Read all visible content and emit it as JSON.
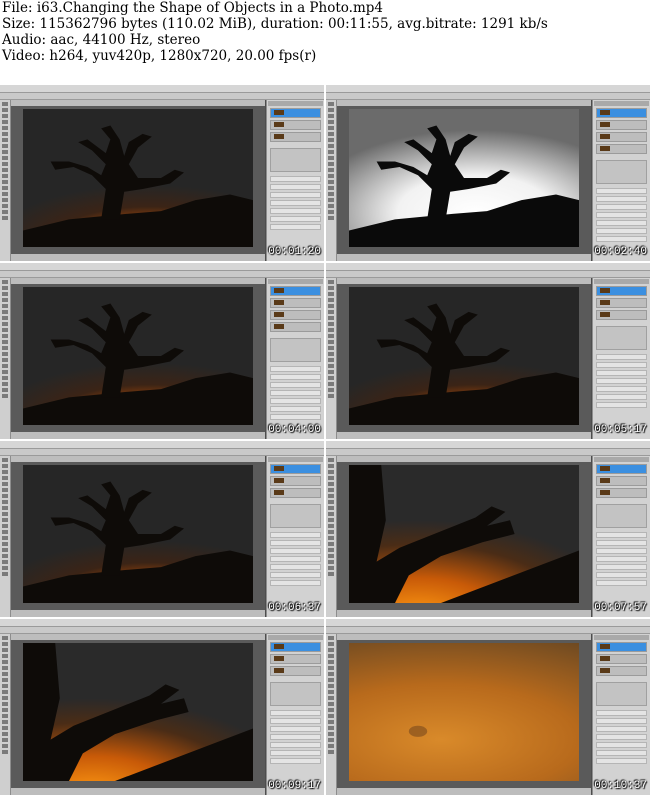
{
  "header": {
    "file_line": "File: i63.Changing the Shape of Objects in a Photo.mp4",
    "size_line": "Size: 115362796 bytes (110.02 MiB), duration: 00:11:55, avg.bitrate: 1291 kb/s",
    "audio_line": "Audio: aac, 44100 Hz, stereo",
    "video_line": "Video: h264, yuv420p, 1280x720, 20.00 fps(r)"
  },
  "thumbnails": [
    {
      "timestamp": "00:01:20",
      "scene": "night"
    },
    {
      "timestamp": "00:02:40",
      "scene": "bw"
    },
    {
      "timestamp": "00:04:00",
      "scene": "night"
    },
    {
      "timestamp": "00:05:17",
      "scene": "night"
    },
    {
      "timestamp": "00:06:37",
      "scene": "night"
    },
    {
      "timestamp": "00:07:57",
      "scene": "zoom"
    },
    {
      "timestamp": "00:09:17",
      "scene": "zoom"
    },
    {
      "timestamp": "00:10:37",
      "scene": "haze"
    }
  ],
  "colors": {
    "selected_layer": "#3b8fe0",
    "timestamp_text": "#ffffff",
    "sky_glow": "#ff9a12"
  }
}
